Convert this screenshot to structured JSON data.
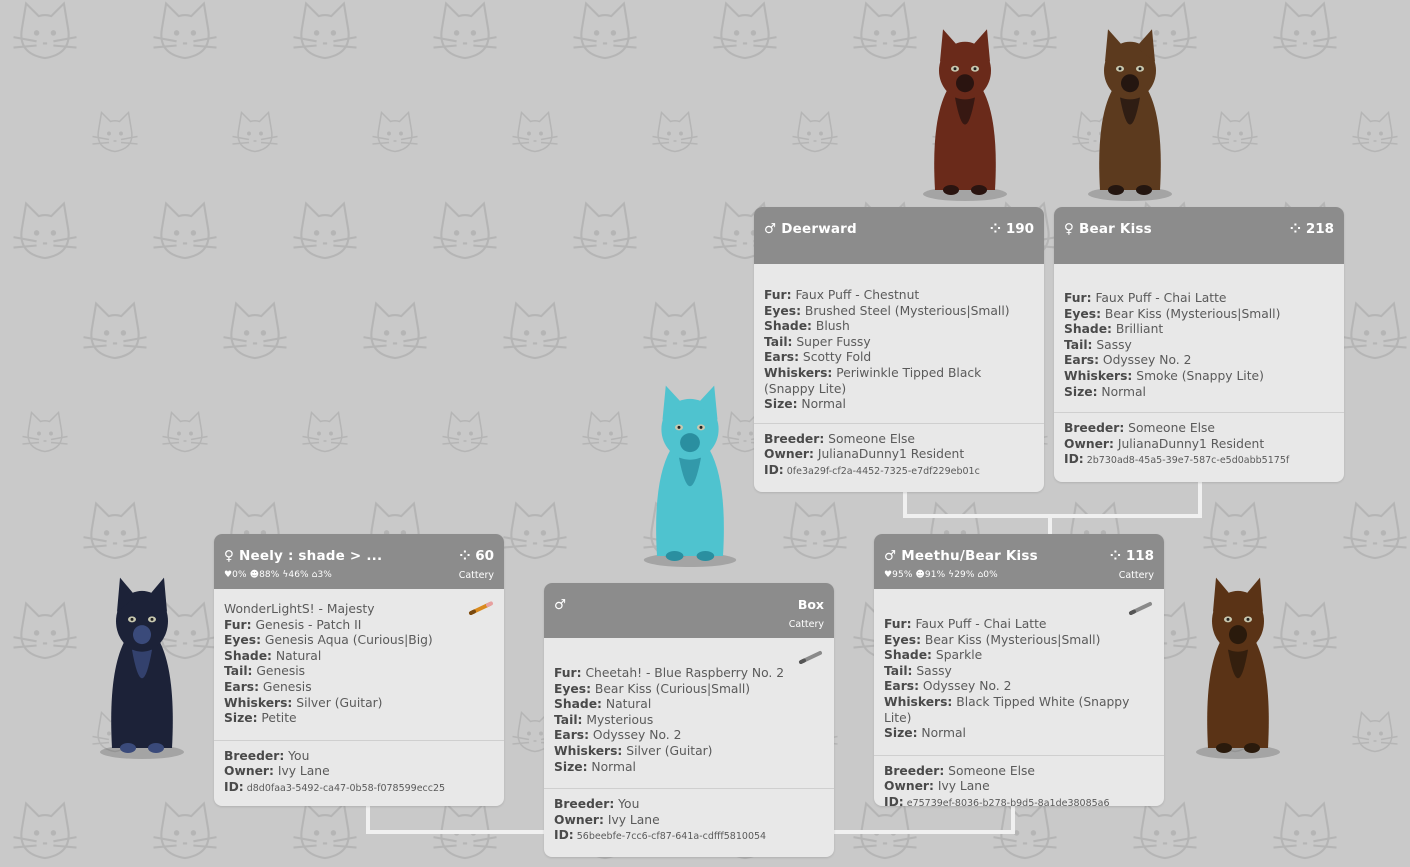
{
  "colors": {
    "background": "#c9c9c9",
    "card_body": "#e8e8e8",
    "card_header": "#8c8c8c",
    "connector": "#f0f0f0"
  },
  "cats": {
    "neely": {
      "gender_symbol": "♀",
      "name": "Neely : shade > ...",
      "generation": "60",
      "stats": "♥0%  ☻88%  ϟ46%  ⌂3%",
      "cattery": "Cattery",
      "title_line": "WonderLightS! - Majesty",
      "fur": "Genesis - Patch II",
      "eyes": "Genesis Aqua (Curious|Big)",
      "shade": "Natural",
      "tail": "Genesis",
      "ears": "Genesis",
      "whiskers": "Silver (Guitar)",
      "size": "Petite",
      "breeder": "You",
      "owner": "Ivy Lane",
      "id": "d8d0faa3-5492-ca47-0b58-f078599ecc25"
    },
    "box": {
      "gender_symbol": "♂",
      "name": "Box",
      "cattery": "Cattery",
      "fur": "Cheetah! - Blue Raspberry No. 2",
      "eyes": "Bear Kiss (Curious|Small)",
      "shade": "Natural",
      "tail": "Mysterious",
      "ears": "Odyssey No. 2",
      "whiskers": "Silver (Guitar)",
      "size": "Normal",
      "breeder": "You",
      "owner": "Ivy Lane",
      "id": "56beebfe-7cc6-cf87-641a-cdfff5810054"
    },
    "meethu": {
      "gender_symbol": "♂",
      "name": "Meethu/Bear Kiss",
      "generation": "118",
      "stats": "♥95%  ☻91%  ϟ29%  ⌂0%",
      "cattery": "Cattery",
      "fur": "Faux Puff - Chai Latte",
      "eyes": "Bear Kiss (Mysterious|Small)",
      "shade": "Sparkle",
      "tail": "Sassy",
      "ears": "Odyssey No. 2",
      "whiskers": "Black Tipped White (Snappy Lite)",
      "size": "Normal",
      "breeder": "Someone Else",
      "owner": "Ivy Lane",
      "id": "e75739ef-8036-b278-b9d5-8a1de38085a6"
    },
    "deerward": {
      "gender_symbol": "♂",
      "name": "Deerward",
      "generation": "190",
      "fur": "Faux Puff - Chestnut",
      "eyes": "Brushed Steel (Mysterious|Small)",
      "shade": "Blush",
      "tail": "Super Fussy",
      "ears": "Scotty Fold",
      "whiskers": "Periwinkle Tipped Black (Snappy Lite)",
      "size": "Normal",
      "breeder": "Someone Else",
      "owner": "JulianaDunny1 Resident",
      "id": "0fe3a29f-cf2a-4452-7325-e7df229eb01c"
    },
    "bearkiss": {
      "gender_symbol": "♀",
      "name": "Bear Kiss",
      "generation": "218",
      "fur": "Faux Puff - Chai Latte",
      "eyes": "Bear Kiss (Mysterious|Small)",
      "shade": "Brilliant",
      "tail": "Sassy",
      "ears": "Odyssey No. 2",
      "whiskers": "Smoke (Snappy Lite)",
      "size": "Normal",
      "breeder": "Someone Else",
      "owner": "JulianaDunny1 Resident",
      "id": "2b730ad8-45a5-39e7-587c-e5d0abb5175f"
    }
  },
  "labels": {
    "fur": "Fur:",
    "eyes": "Eyes:",
    "shade": "Shade:",
    "tail": "Tail:",
    "ears": "Ears:",
    "whiskers": "Whiskers:",
    "size": "Size:",
    "breeder": "Breeder:",
    "owner": "Owner:",
    "id": "ID:"
  }
}
